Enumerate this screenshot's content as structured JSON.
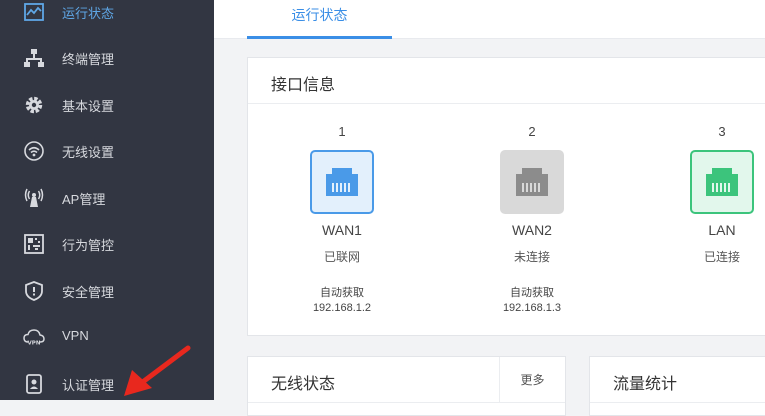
{
  "sidebar": {
    "items": [
      {
        "label": "运行状态",
        "icon": "chart-icon"
      },
      {
        "label": "终端管理",
        "icon": "network-tree-icon"
      },
      {
        "label": "基本设置",
        "icon": "gear-icon"
      },
      {
        "label": "无线设置",
        "icon": "wifi-icon"
      },
      {
        "label": "AP管理",
        "icon": "antenna-icon"
      },
      {
        "label": "行为管控",
        "icon": "qr-icon"
      },
      {
        "label": "安全管理",
        "icon": "shield-icon"
      },
      {
        "label": "VPN",
        "icon": "vpn-cloud-icon"
      },
      {
        "label": "认证管理",
        "icon": "id-badge-icon"
      }
    ]
  },
  "tabs": {
    "active": "运行状态"
  },
  "interface_card": {
    "title": "接口信息",
    "ports": [
      {
        "num": "1",
        "name": "WAN1",
        "state": "已联网",
        "mode": "自动获取",
        "ip": "192.168.1.2",
        "color": "#4a9ae8",
        "bg": "#e3f0fc"
      },
      {
        "num": "2",
        "name": "WAN2",
        "state": "未连接",
        "mode": "自动获取",
        "ip": "192.168.1.3",
        "color": "#8c8c8c",
        "bg": "#d9d9d9"
      },
      {
        "num": "3",
        "name": "LAN",
        "state": "已连接",
        "mode": "",
        "ip": "",
        "color": "#3cc47c",
        "bg": "#e2f7ec"
      }
    ]
  },
  "wireless_card": {
    "title": "无线状态",
    "more_label": "更多"
  },
  "traffic_card": {
    "title": "流量统计"
  },
  "colors": {
    "sidebar_bg": "#323642",
    "accent": "#3a8ee6",
    "arrow": "#e8281e"
  }
}
